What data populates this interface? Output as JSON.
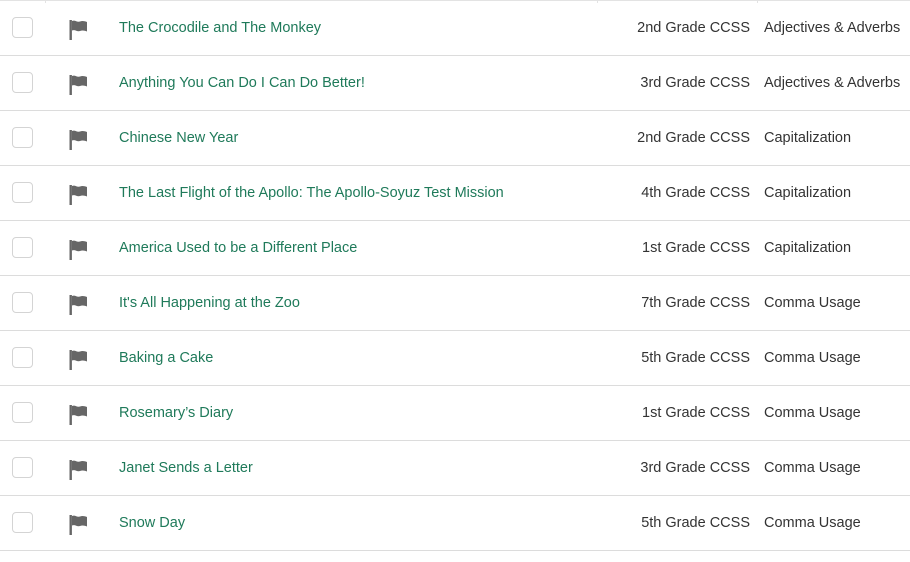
{
  "rows": [
    {
      "title": "The Crocodile and The Monkey",
      "grade": "2nd Grade CCSS",
      "topic": "Adjectives & Adverbs",
      "flag_icon": "flag-icon"
    },
    {
      "title": "Anything You Can Do I Can Do Better!",
      "grade": "3rd Grade CCSS",
      "topic": "Adjectives & Adverbs",
      "flag_icon": "flag-icon"
    },
    {
      "title": "Chinese New Year",
      "grade": "2nd Grade CCSS",
      "topic": "Capitalization",
      "flag_icon": "flag-icon"
    },
    {
      "title": "The Last Flight of the Apollo: The Apollo-Soyuz Test Mission",
      "grade": "4th Grade CCSS",
      "topic": "Capitalization",
      "flag_icon": "flag-icon"
    },
    {
      "title": "America Used to be a Different Place",
      "grade": "1st Grade CCSS",
      "topic": "Capitalization",
      "flag_icon": "flag-icon"
    },
    {
      "title": "It's All Happening at the Zoo",
      "grade": "7th Grade CCSS",
      "topic": "Comma Usage",
      "flag_icon": "flag-icon"
    },
    {
      "title": "Baking a Cake",
      "grade": "5th Grade CCSS",
      "topic": "Comma Usage",
      "flag_icon": "flag-icon"
    },
    {
      "title": "Rosemary’s Diary",
      "grade": "1st Grade CCSS",
      "topic": "Comma Usage",
      "flag_icon": "flag-icon"
    },
    {
      "title": "Janet Sends a Letter",
      "grade": "3rd Grade CCSS",
      "topic": "Comma Usage",
      "flag_icon": "flag-icon"
    },
    {
      "title": "Snow Day",
      "grade": "5th Grade CCSS",
      "topic": "Comma Usage",
      "flag_icon": "flag-icon"
    }
  ],
  "colors": {
    "title_link": "#1f7a5a",
    "text": "#333333",
    "flag": "#666666",
    "row_border": "#dcdcdc"
  }
}
